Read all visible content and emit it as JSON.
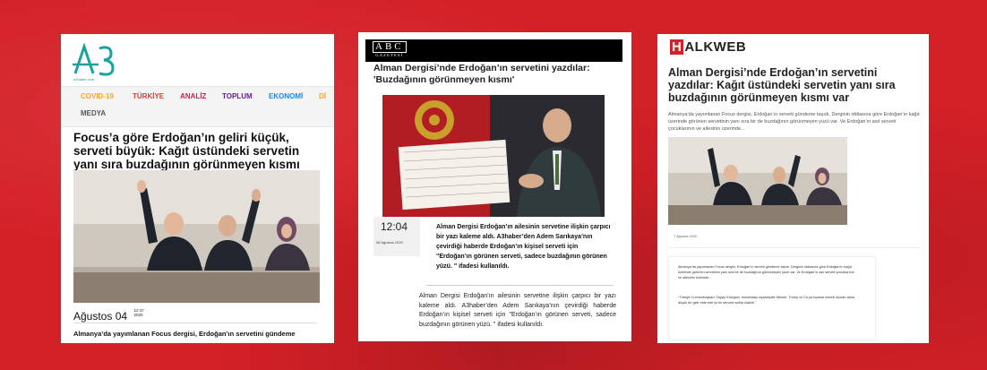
{
  "card_a3": {
    "logo_text": "A3",
    "logo_caption": "a3haber.com",
    "nav": [
      {
        "label": "COVID-19",
        "color": "#f5a623"
      },
      {
        "label": "TÜRKİYE",
        "color": "#e53935"
      },
      {
        "label": "ANALİZ",
        "color": "#d81b60"
      },
      {
        "label": "TOPLUM",
        "color": "#6a1b9a"
      },
      {
        "label": "EKONOMİ",
        "color": "#1e88e5"
      },
      {
        "label": "Dİ",
        "color": "#f5a623"
      },
      {
        "label": "MEDYA",
        "color": "#555555"
      }
    ],
    "headline": "Focus’a göre Erdoğan’ın geliri küçük, serveti büyük: Kağıt üstündeki servetin yanı sıra buzdağının görünmeyen kısmı var",
    "date_main": "Ağustos 04",
    "date_time": "12:47",
    "date_year": "2020",
    "lead": "Almanya’da yayımlanan Focus dergisi, Erdoğan’ın servetini gündeme"
  },
  "card_abc": {
    "logo_letters": "ABC",
    "logo_sub": "GAZETESİ",
    "headline": "Alman Dergisi’nde Erdoğan’ın servetini yazdılar: 'Buzdağının görünmeyen kısmı'",
    "time": "12:04",
    "date": "08 Ağustos 2020",
    "lead": "Alman Dergisi Erdoğan’ın ailesinin servetine ilişkin çarpıcı bir yazı kaleme aldı. A3haber’den Adem Sarıkaya’nın çevirdiği haberde Erdoğan’ın kişisel serveti için \"Erdoğan’ın görünen serveti, sadece buzdağının görünen yüzü. \" ifadesi kullanıldı.",
    "body": "Alman Dergisi Erdoğan’ın ailesinin servetine ilişkin çarpıcı bir yazı kaleme aldı. A3haber’den Adem Sarıkaya’nın çevirdiği haberde Erdoğan’ın kişisel serveti için \"Erdoğan’ın görünen serveti, sadece buzdağının görünen yüzü. \" ifadesi kullanıldı."
  },
  "card_halk": {
    "logo_h": "H",
    "logo_rest": "ALKWEB",
    "headline": "Alman Dergisi’nde Erdoğan’ın servetini yazdılar: Kağıt üstündeki servetin yanı sıra buzdağının görünmeyen kısmı var",
    "intro": "Almanya’da yayımlanan Focus dergisi, Erdoğan’ın serveti gündeme taşıdı. Derginin iddiasına göre Erdoğan’ın kağıt üzerinde görünen servetinin yanı sıra bir de buzdağının görünmeyen yüzü var. Ve Erdoğan’ın asıl serveti çocuklarının ve ailesinin üzerinde...",
    "date": "7 Ağustos 2020",
    "p1": "Almanya’da yayımlanan Focus dergisi, Erdoğan’ın serveti gündeme taşıdı. Derginin iddiasına göre Erdoğan’ın kağıt üzerinde görünen servetinin yanı sıra bir de buzdağının görünmeyen yüzü var. Ve Erdoğan’ın asıl serveti çocuklarının ve ailesinin üzerinde...",
    "p2": "“Türkiye Cumhurbaşkanı Tayyip Erdoğan, meslektaşı siyasetçiler Merkel, Trump ve Co’ya kıyasla önemli ölçüde daha düşük bir gelir elde ede iyi bir servete sahip olabilir.”"
  }
}
